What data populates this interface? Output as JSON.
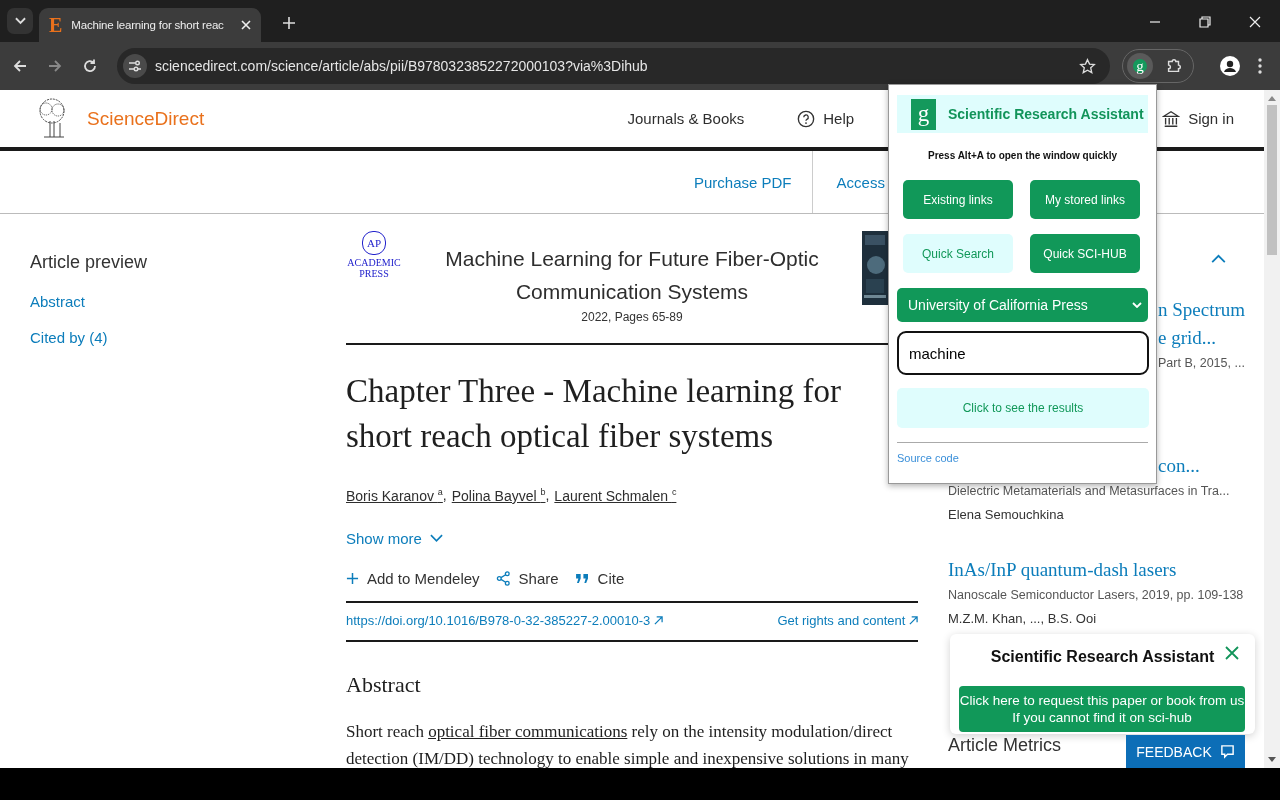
{
  "browser": {
    "tab": {
      "favicon": "E",
      "title": "Machine learning for short reac"
    },
    "url": "sciencedirect.com/science/article/abs/pii/B9780323852272000103?via%3Dihub",
    "extension_letter": "g"
  },
  "header": {
    "brand": "ScienceDirect",
    "journals": "Journals & Books",
    "help": "Help",
    "sign_in": "Sign in"
  },
  "subbar": [
    "Purchase PDF",
    "Access"
  ],
  "sidebar": {
    "title": "Article preview",
    "links": [
      "Abstract",
      "Cited by (4)"
    ]
  },
  "article": {
    "publisher": [
      "ACADEMIC",
      "PRESS"
    ],
    "publisher_mark": "AP",
    "book_title": "Machine Learning for Future Fiber-Optic Communication Systems",
    "meta": "2022, Pages 65-89",
    "title": "Chapter Three - Machine learning for short reach optical fiber systems",
    "authors": [
      {
        "name": "Boris Karanov",
        "sup": "a"
      },
      {
        "name": "Polina Bayvel",
        "sup": "b"
      },
      {
        "name": "Laurent Schmalen",
        "sup": "c"
      }
    ],
    "author_separator": ",",
    "show_more": "Show more",
    "actions": [
      {
        "kind": "plus",
        "label": "Add to Mendeley"
      },
      {
        "kind": "share",
        "label": "Share"
      },
      {
        "kind": "quote",
        "label": "Cite"
      }
    ],
    "doi": "https://doi.org/10.1016/B978-0-32-385227-2.00010-3",
    "rights": "Get rights and content",
    "abstract_heading": "Abstract",
    "abstract": {
      "before": "Short reach ",
      "link": "optical fiber communications",
      "after": " rely on the intensity modulation/direct detection (IM/DD) technology to enable simple and inexpensive solutions in many"
    }
  },
  "recommended": [
    {
      "title_lines": [
        "n Spectrum",
        "e grid..."
      ],
      "source": "Part B, 2015, ...",
      "partial": true
    },
    {
      "title_lines": [
        "con..."
      ],
      "source": "Dielectric Metamaterials and Metasurfaces in Tra...",
      "authors": "Elena Semouchkina",
      "partial": true
    },
    {
      "title_lines": [
        "InAs/InP quantum-dash lasers"
      ],
      "source": "Nanoscale Semiconductor Lasers, 2019, pp. 109-138",
      "authors": "M.Z.M. Khan, ..., B.S. Ooi",
      "partial": false
    }
  ],
  "metrics_heading": "Article Metrics",
  "feedback": "FEEDBACK",
  "popup": {
    "logo": "g",
    "title": "Scientific Research Assistant",
    "hint": "Press Alt+A to open the window quickly",
    "buttons": [
      {
        "label": "Existing links",
        "kind": "solid"
      },
      {
        "label": "My stored links",
        "kind": "solid"
      },
      {
        "label": "Quick Search",
        "kind": "light"
      },
      {
        "label": "Quick SCI-HUB",
        "kind": "solid"
      }
    ],
    "select": "University of California Press",
    "input": "machine",
    "results": "Click to see the results",
    "source": "Source code"
  },
  "toast": {
    "title": "Scientific Research Assistant",
    "button_lines": [
      "Click here to request this paper or book from us",
      "If you cannot find it on sci-hub"
    ]
  }
}
